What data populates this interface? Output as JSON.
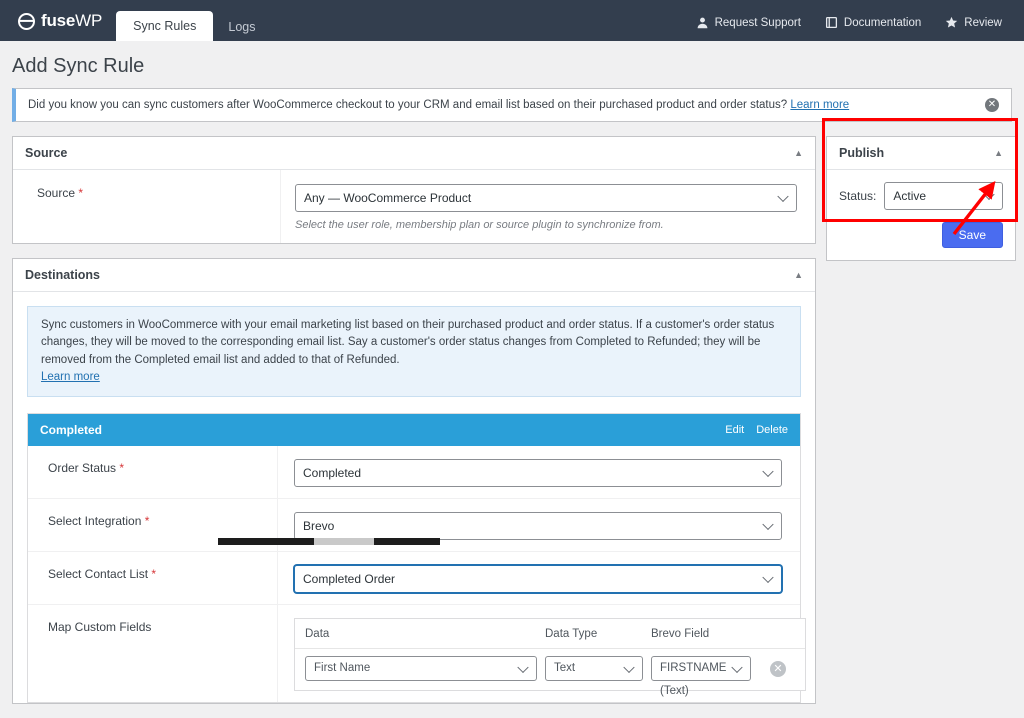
{
  "brand": {
    "name_bold": "fuse",
    "name_light": "WP",
    "logo_icon": "fusewp-logo-icon"
  },
  "tabs": [
    {
      "label": "Sync Rules",
      "active": true
    },
    {
      "label": "Logs",
      "active": false
    }
  ],
  "topnav": [
    {
      "label": "Request Support",
      "icon": "user-support-icon"
    },
    {
      "label": "Documentation",
      "icon": "book-icon"
    },
    {
      "label": "Review",
      "icon": "star-icon"
    }
  ],
  "page": {
    "title": "Add Sync Rule"
  },
  "notice": {
    "text": "Did you know you can sync customers after WooCommerce checkout to your CRM and email list based on their purchased product and order status?",
    "link": "Learn more",
    "dismiss": "✕"
  },
  "source_panel": {
    "title": "Source",
    "collapse_icon": "chevron-up-icon",
    "label": "Source",
    "required_mark": "*",
    "value": "Any — WooCommerce Product",
    "hint": "Select the user role, membership plan or source plugin to synchronize from."
  },
  "destinations_panel": {
    "title": "Destinations",
    "collapse_icon": "chevron-up-icon",
    "notice": "Sync customers in WooCommerce with your email marketing list based on their purchased product and order status. If a customer's order status changes, they will be moved to the corresponding email list. Say a customer's order status changes from Completed to Refunded; they will be removed from the Completed email list and added to that of Refunded.",
    "notice_link": "Learn more",
    "card": {
      "title": "Completed",
      "edit_label": "Edit",
      "delete_label": "Delete",
      "rows": [
        {
          "label": "Order Status",
          "required": "*",
          "value": "Completed",
          "focused": false
        },
        {
          "label": "Select Integration",
          "required": "*",
          "value": "Brevo",
          "focused": false
        },
        {
          "label": "Select Contact List",
          "required": "*",
          "value": "Completed Order",
          "focused": true
        }
      ],
      "map_fields": {
        "label": "Map Custom Fields",
        "columns": [
          "Data",
          "Data Type",
          "Brevo Field"
        ],
        "rows": [
          {
            "data": "First Name",
            "data_type": "Text",
            "crm_field": "FIRSTNAME (Text)",
            "remove_icon": "✕"
          }
        ]
      }
    }
  },
  "publish_panel": {
    "title": "Publish",
    "collapse_icon": "chevron-up-icon",
    "status_label": "Status:",
    "status_value": "Active",
    "save_label": "Save"
  },
  "colors": {
    "topbar": "#333e4e",
    "accent_blue": "#2a9fd8",
    "save_button": "#4a6cf0",
    "annotation_red": "#ff0000",
    "link": "#2271b1",
    "required": "#d63638"
  }
}
